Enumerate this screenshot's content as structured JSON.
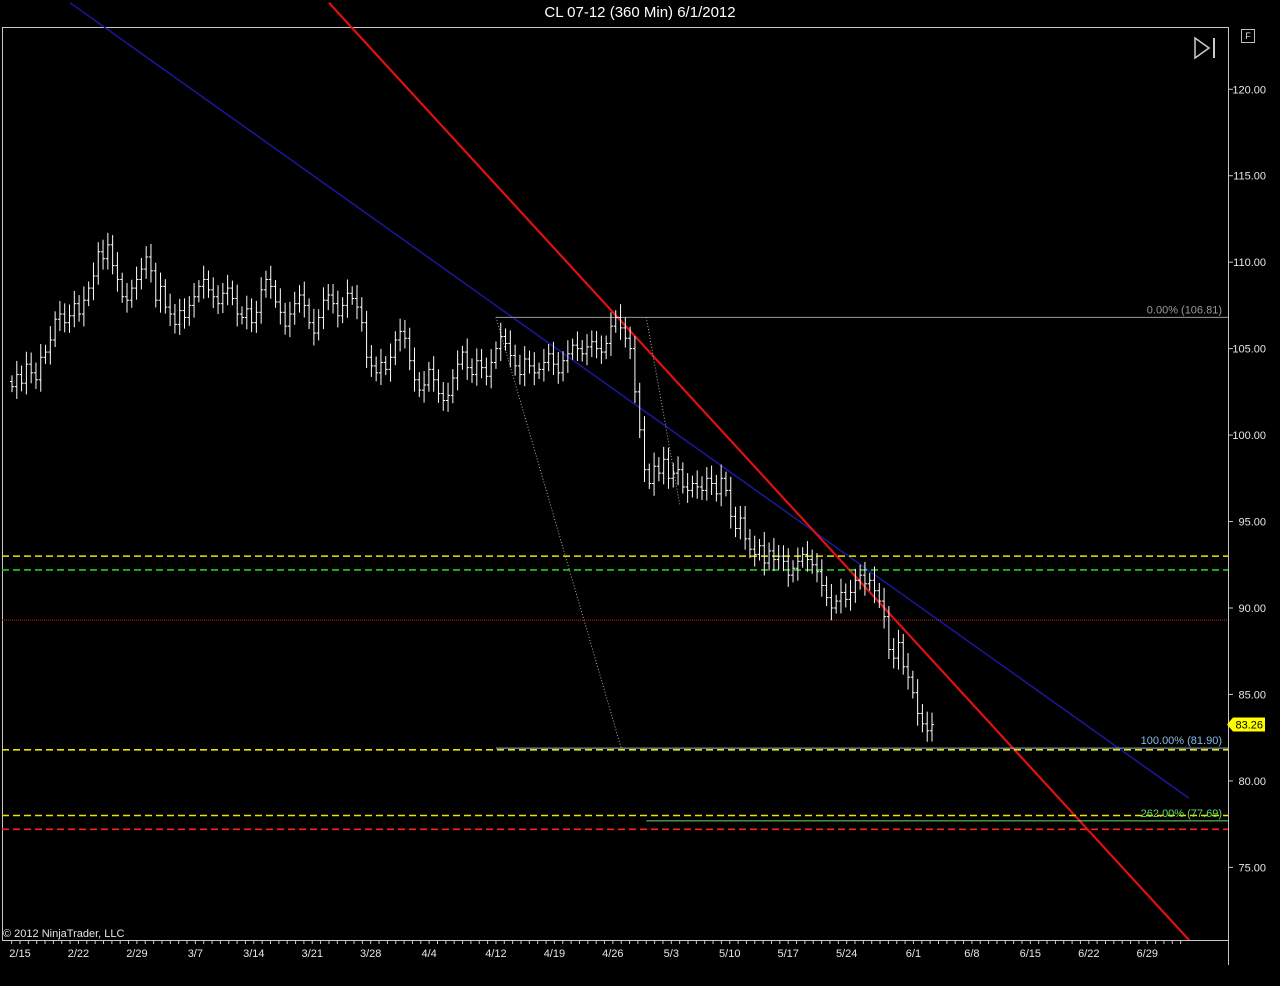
{
  "window": {
    "title": "CL 07-12 (360 Min)  6/1/2012",
    "copyright": "© 2012 NinjaTrader, LLC",
    "f_button_label": "F",
    "play_icon": "skip-to-end-icon"
  },
  "colors": {
    "background": "#000000",
    "bars": "#ffffff",
    "blue_trendline": "#1a1aa6",
    "red_trendline": "#e01010",
    "yellow_dashed": "#e6e600",
    "green_dashed": "#22cc22",
    "red_dotted": "#c82020",
    "red_dashed": "#ff2020",
    "fib_0": "#9a9a9a",
    "fib_100": "#88bbe6",
    "fib_262": "#66dd66",
    "price_badge": "#ffff00"
  },
  "chart_data": {
    "type": "ohlc",
    "instrument": "CL 07-12",
    "interval": "360 Min",
    "x_tick_labels": [
      "2/15",
      "2/22",
      "2/29",
      "3/7",
      "3/14",
      "3/21",
      "3/28",
      "4/4",
      "4/12",
      "4/19",
      "4/26",
      "5/3",
      "5/10",
      "5/17",
      "5/24",
      "6/1",
      "6/8",
      "6/15",
      "6/22",
      "6/29"
    ],
    "y_ticks": [
      75,
      80,
      85,
      90,
      95,
      100,
      105,
      110,
      115,
      120
    ],
    "y_tick_labels": [
      "75.00",
      "80.00",
      "85.00",
      "90.00",
      "95.00",
      "100.00",
      "105.00",
      "110.00",
      "115.00",
      "120.00"
    ],
    "ylim": [
      70.8,
      123.6
    ],
    "last_price": 83.26,
    "last_price_label": "83.26",
    "closes": [
      102.8,
      103.5,
      103.0,
      104.1,
      103.6,
      103.2,
      104.5,
      104.8,
      105.5,
      106.7,
      107.0,
      106.5,
      106.9,
      107.6,
      107.0,
      107.8,
      108.5,
      109.2,
      110.6,
      110.2,
      111.0,
      109.8,
      109.0,
      108.0,
      107.8,
      108.5,
      109.0,
      109.6,
      110.3,
      109.5,
      107.8,
      108.6,
      107.4,
      107.0,
      106.4,
      107.2,
      106.8,
      107.5,
      108.0,
      108.6,
      109.0,
      108.4,
      108.0,
      107.6,
      108.2,
      108.5,
      107.9,
      107.0,
      106.8,
      107.3,
      106.5,
      107.1,
      108.4,
      109.0,
      108.6,
      107.7,
      107.1,
      106.3,
      107.0,
      107.6,
      108.1,
      107.5,
      106.5,
      105.9,
      106.8,
      107.8,
      108.1,
      107.6,
      106.9,
      107.5,
      108.2,
      107.9,
      107.4,
      106.5,
      104.5,
      104.0,
      103.6,
      104.2,
      103.8,
      104.5,
      105.5,
      106.0,
      105.6,
      104.3,
      103.2,
      102.6,
      102.9,
      103.8,
      103.2,
      102.4,
      102.0,
      102.3,
      103.3,
      104.1,
      104.8,
      103.9,
      103.5,
      104.3,
      103.9,
      103.4,
      104.2,
      105.0,
      105.7,
      105.3,
      104.6,
      104.0,
      103.5,
      104.4,
      104.0,
      103.6,
      103.8,
      104.2,
      104.7,
      104.1,
      103.6,
      104.3,
      104.7,
      105.2,
      105.0,
      104.7,
      105.1,
      105.4,
      105.0,
      104.8,
      105.3,
      106.3,
      106.8,
      106.2,
      105.6,
      105.0,
      102.5,
      100.3,
      98.0,
      97.2,
      98.2,
      97.8,
      98.6,
      97.5,
      97.8,
      98.0,
      97.0,
      96.8,
      97.2,
      97.0,
      96.8,
      97.5,
      97.2,
      96.6,
      97.5,
      96.8,
      95.3,
      94.6,
      95.2,
      94.0,
      93.4,
      93.1,
      93.6,
      92.6,
      93.3,
      92.8,
      93.0,
      92.7,
      91.9,
      92.3,
      92.7,
      93.1,
      92.8,
      92.5,
      92.1,
      91.3,
      90.6,
      90.0,
      90.4,
      90.9,
      90.5,
      90.9,
      91.6,
      91.9,
      91.4,
      91.6,
      91.0,
      90.4,
      89.5,
      87.6,
      87.1,
      88.0,
      86.6,
      86.0,
      85.1,
      83.9,
      83.3,
      82.9,
      83.26
    ],
    "overlays": [
      {
        "kind": "trendline",
        "color_key": "blue_trendline",
        "x1": "2/21",
        "y1": 125.0,
        "x2": "7/4",
        "y2": 79.0
      },
      {
        "kind": "trendline",
        "color_key": "red_trendline",
        "x1": "3/23",
        "y1": 125.0,
        "x2": "7/4",
        "y2": 70.8
      },
      {
        "kind": "hline",
        "style": "dashed",
        "color_key": "yellow_dashed",
        "y": 93.0
      },
      {
        "kind": "hline",
        "style": "dashed",
        "color_key": "green_dashed",
        "y": 92.2
      },
      {
        "kind": "hline",
        "style": "dotted",
        "color_key": "red_dotted",
        "y": 89.3
      },
      {
        "kind": "hline",
        "style": "dashed",
        "color_key": "yellow_dashed",
        "y": 81.8
      },
      {
        "kind": "hline",
        "style": "dashed",
        "color_key": "yellow_dashed",
        "y": 78.0
      },
      {
        "kind": "hline",
        "style": "dashed",
        "color_key": "red_dashed",
        "y": 77.2
      }
    ],
    "fib_levels": [
      {
        "label": "0.00% (106.81)",
        "value": 106.81,
        "color_key": "fib_0",
        "from_date": "4/12"
      },
      {
        "label": "100.00% (81.90)",
        "value": 81.9,
        "color_key": "fib_100",
        "from_date": "4/12"
      },
      {
        "label": "262.00% (77.69)",
        "value": 77.69,
        "color_key": "fib_262",
        "from_date": "4/30"
      }
    ],
    "fib_lines": [
      {
        "x1": "4/12",
        "y1": 106.81,
        "x2": "4/27",
        "y2": 81.9
      },
      {
        "x1": "4/30",
        "y1": 106.81,
        "x2": "5/4",
        "y2": 96.0
      }
    ]
  }
}
